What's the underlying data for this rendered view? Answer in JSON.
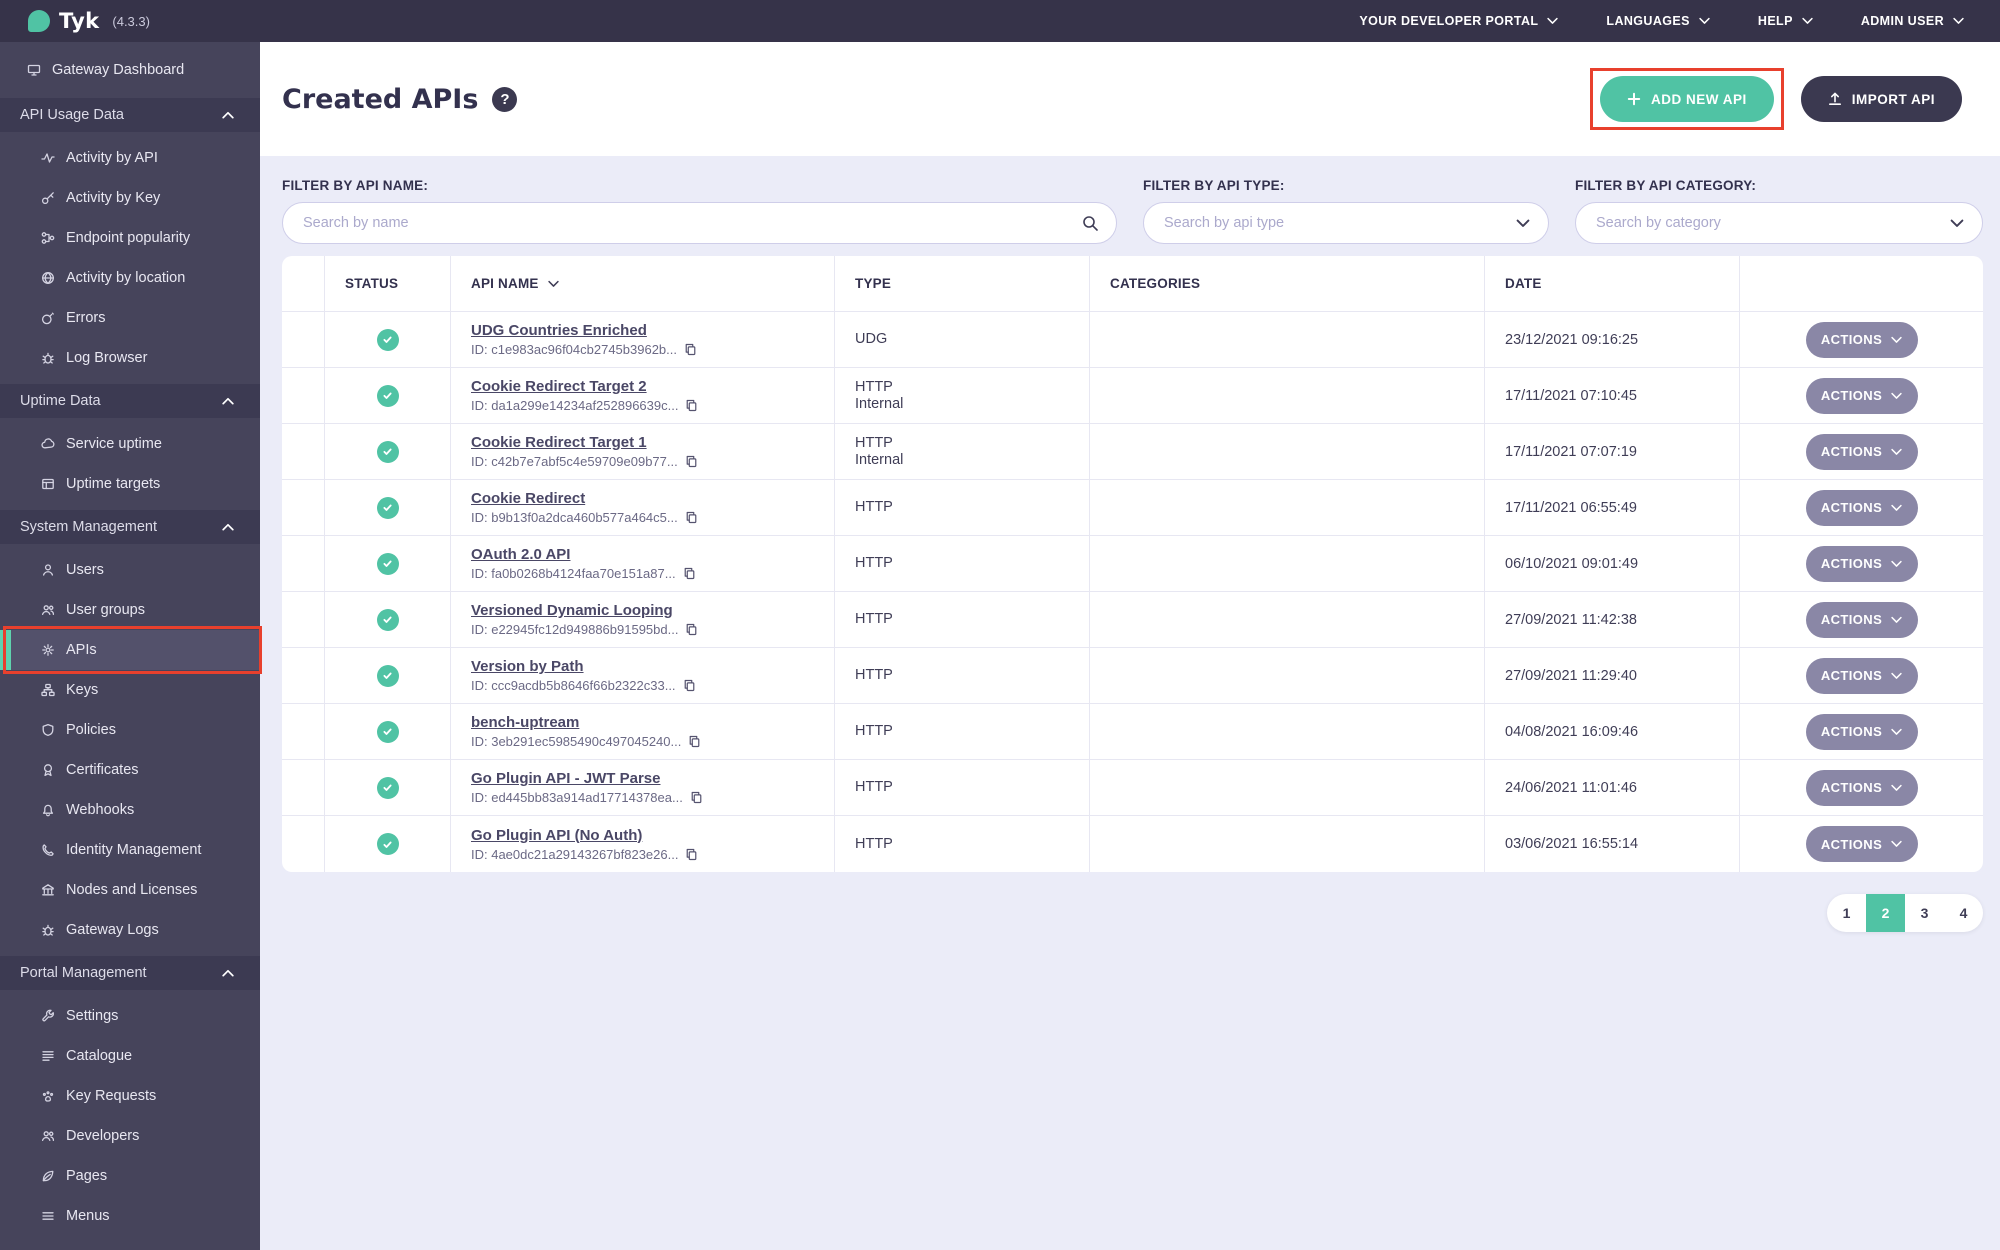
{
  "topbar": {
    "brand": "Tyk",
    "version": "(4.3.3)",
    "menus": [
      "YOUR DEVELOPER PORTAL",
      "LANGUAGES",
      "HELP",
      "ADMIN USER"
    ]
  },
  "sidebar": {
    "standalone": {
      "label": "Gateway Dashboard",
      "icon": "monitor"
    },
    "sections": [
      {
        "title": "API Usage Data",
        "items": [
          {
            "label": "Activity by API",
            "icon": "pulse"
          },
          {
            "label": "Activity by Key",
            "icon": "key"
          },
          {
            "label": "Endpoint popularity",
            "icon": "branch"
          },
          {
            "label": "Activity by location",
            "icon": "globe"
          },
          {
            "label": "Errors",
            "icon": "bomb"
          },
          {
            "label": "Log Browser",
            "icon": "bug"
          }
        ]
      },
      {
        "title": "Uptime Data",
        "items": [
          {
            "label": "Service uptime",
            "icon": "cloud"
          },
          {
            "label": "Uptime targets",
            "icon": "grid"
          }
        ]
      },
      {
        "title": "System Management",
        "items": [
          {
            "label": "Users",
            "icon": "user"
          },
          {
            "label": "User groups",
            "icon": "users"
          },
          {
            "label": "APIs",
            "icon": "gears",
            "selected": true
          },
          {
            "label": "Keys",
            "icon": "sitemap"
          },
          {
            "label": "Policies",
            "icon": "shield"
          },
          {
            "label": "Certificates",
            "icon": "certificate"
          },
          {
            "label": "Webhooks",
            "icon": "bell"
          },
          {
            "label": "Identity Management",
            "icon": "phone"
          },
          {
            "label": "Nodes and Licenses",
            "icon": "bank"
          },
          {
            "label": "Gateway Logs",
            "icon": "bug"
          }
        ]
      },
      {
        "title": "Portal Management",
        "items": [
          {
            "label": "Settings",
            "icon": "wrench"
          },
          {
            "label": "Catalogue",
            "icon": "catalogue"
          },
          {
            "label": "Key Requests",
            "icon": "paw"
          },
          {
            "label": "Developers",
            "icon": "users"
          },
          {
            "label": "Pages",
            "icon": "leaf"
          },
          {
            "label": "Menus",
            "icon": "menu"
          }
        ]
      }
    ]
  },
  "header": {
    "title": "Created APIs",
    "help": "?",
    "add_button": "ADD NEW API",
    "import_button": "IMPORT API"
  },
  "filters": {
    "name": {
      "label": "FILTER BY API NAME:",
      "placeholder": "Search by name"
    },
    "type": {
      "label": "FILTER BY API TYPE:",
      "placeholder": "Search by api type"
    },
    "category": {
      "label": "FILTER BY API CATEGORY:",
      "placeholder": "Search by category"
    }
  },
  "table": {
    "columns": {
      "status": "STATUS",
      "name": "API NAME",
      "type": "TYPE",
      "categories": "CATEGORIES",
      "date": "DATE"
    },
    "actions_label": "ACTIONS",
    "rows": [
      {
        "status": "active",
        "name": "UDG Countries Enriched",
        "id": "ID: c1e983ac96f04cb2745b3962b...",
        "type": "UDG",
        "date": "23/12/2021 09:16:25"
      },
      {
        "status": "active",
        "name": "Cookie Redirect Target 2",
        "id": "ID: da1a299e14234af252896639c...",
        "type": "HTTP",
        "type2": "Internal",
        "date": "17/11/2021 07:10:45"
      },
      {
        "status": "active",
        "name": "Cookie Redirect Target 1",
        "id": "ID: c42b7e7abf5c4e59709e09b77...",
        "type": "HTTP",
        "type2": "Internal",
        "date": "17/11/2021 07:07:19"
      },
      {
        "status": "active",
        "name": "Cookie Redirect",
        "id": "ID: b9b13f0a2dca460b577a464c5...",
        "type": "HTTP",
        "date": "17/11/2021 06:55:49"
      },
      {
        "status": "active",
        "name": "OAuth 2.0 API",
        "id": "ID: fa0b0268b4124faa70e151a87...",
        "type": "HTTP",
        "date": "06/10/2021 09:01:49"
      },
      {
        "status": "active",
        "name": "Versioned Dynamic Looping",
        "id": "ID: e22945fc12d949886b91595bd...",
        "type": "HTTP",
        "date": "27/09/2021 11:42:38"
      },
      {
        "status": "active",
        "name": "Version by Path",
        "id": "ID: ccc9acdb5b8646f66b2322c33...",
        "type": "HTTP",
        "date": "27/09/2021 11:29:40"
      },
      {
        "status": "active",
        "name": "bench-uptream",
        "id": "ID: 3eb291ec5985490c497045240...",
        "type": "HTTP",
        "date": "04/08/2021 16:09:46"
      },
      {
        "status": "active",
        "name": "Go Plugin API - JWT Parse",
        "id": "ID: ed445bb83a914ad17714378ea...",
        "type": "HTTP",
        "date": "24/06/2021 11:01:46"
      },
      {
        "status": "active",
        "name": "Go Plugin API (No Auth)",
        "id": "ID: 4ae0dc21a29143267bf823e26...",
        "type": "HTTP",
        "date": "03/06/2021 16:55:14"
      }
    ]
  },
  "pagination": {
    "pages": [
      "1",
      "2",
      "3",
      "4"
    ],
    "active": "2"
  },
  "icons": [
    "tyk-leaf-logo",
    "chevron-down",
    "chevron-up",
    "search",
    "plus",
    "upload",
    "question-mark",
    "check",
    "copy",
    "sort-chevron"
  ],
  "colors": {
    "accent_teal": "#50C3A4",
    "annotation_red": "#E8402D",
    "topbar_bg": "#363349",
    "sidebar_bg": "#46445B",
    "section_bg": "#3C3A52",
    "page_bg": "#EBECF8",
    "actions_button": "#8A87A6"
  }
}
